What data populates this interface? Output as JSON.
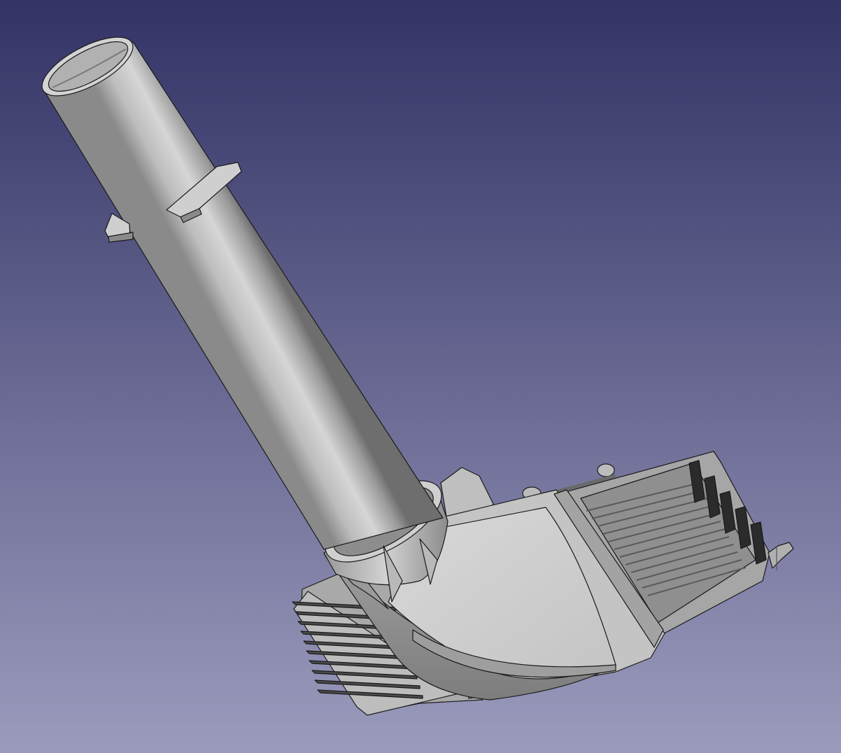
{
  "viewport": {
    "background": {
      "top_color": "#333366",
      "bottom_color": "#9b9bbd"
    },
    "model": {
      "body_color": "#c8c8c8",
      "light_color": "#e6e6e6",
      "shadow_color": "#7c7c7c",
      "edge_color": "#1a1a1a",
      "fin_count_right": 5,
      "fin_count_left": 10
    }
  }
}
